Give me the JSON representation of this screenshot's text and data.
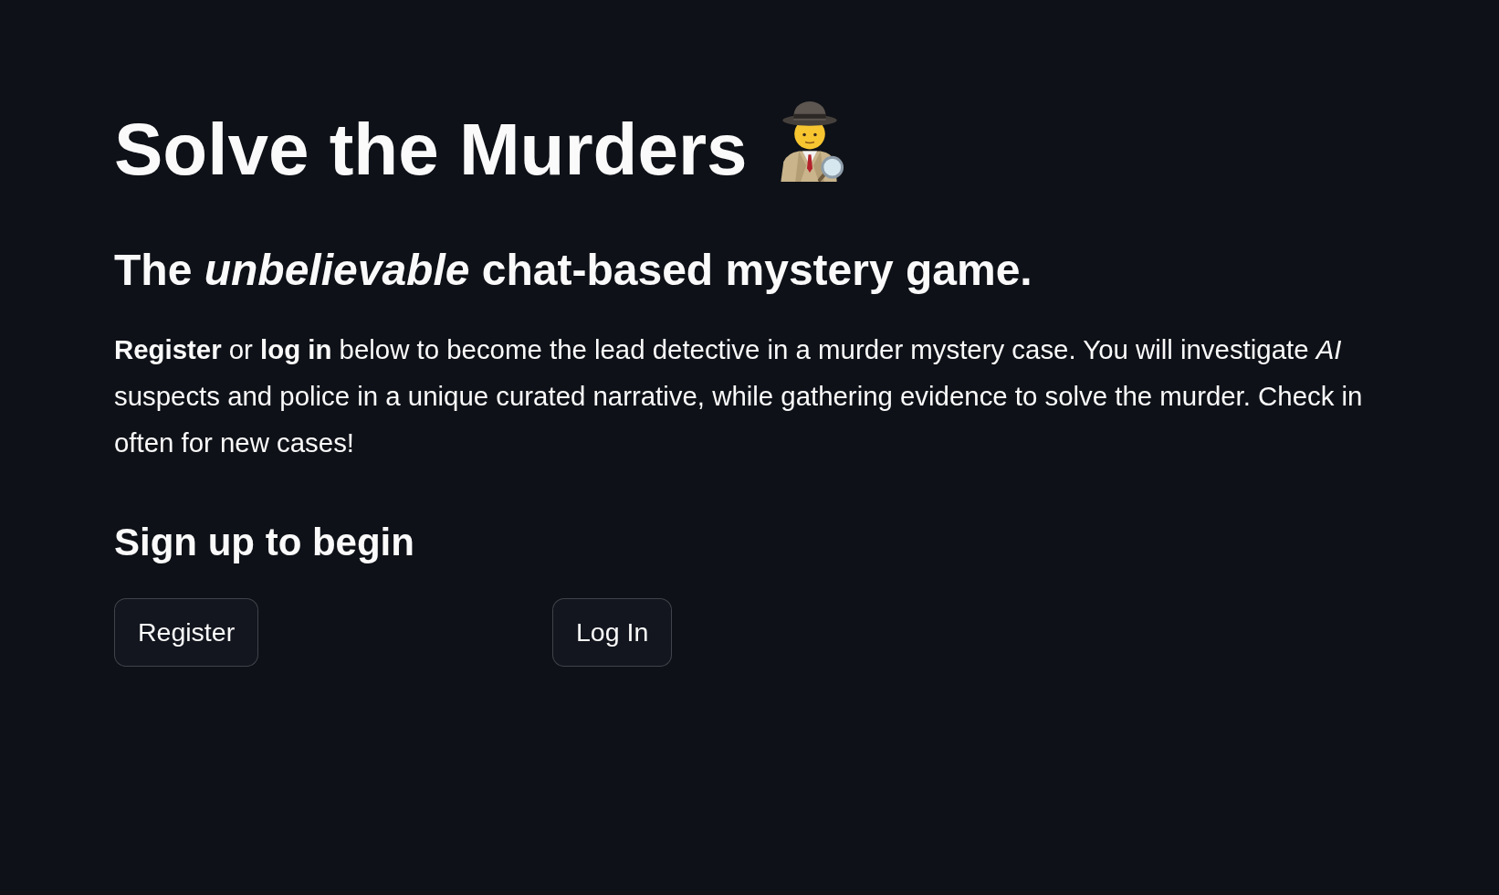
{
  "title": "Solve the Murders",
  "subtitle": "The *unbelievable* chat-based mystery game.",
  "intro": "**Register** or **log in** below to become the lead detective in a murder mystery case. You will investigate *AI* suspects and police in a unique curated narrative, while gathering evidence to solve the murder. Check in often for new cases!",
  "section_heading": "Sign up to begin",
  "buttons": [
    {
      "label": "Register"
    },
    {
      "label": "Log In"
    }
  ]
}
